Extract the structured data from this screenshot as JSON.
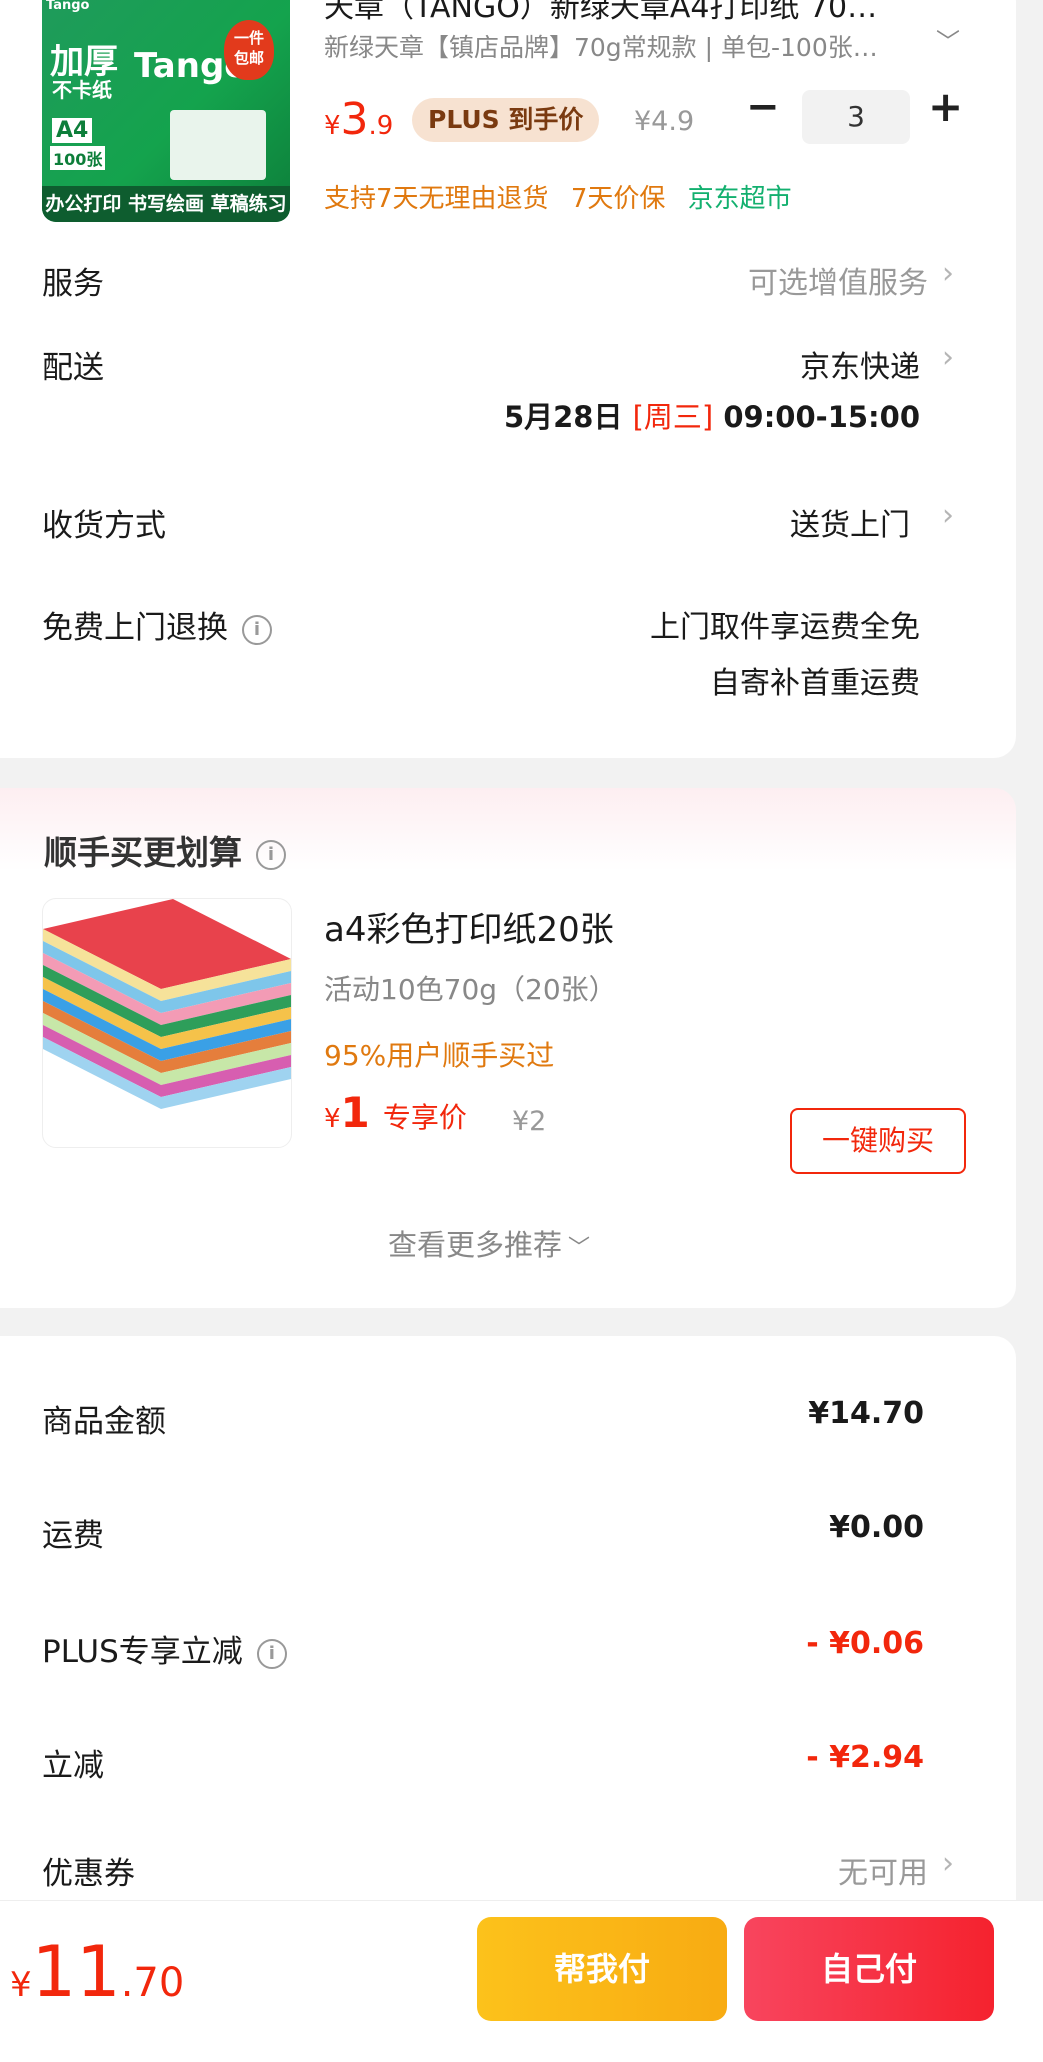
{
  "product": {
    "title": "天章（TANGO）新绿天章A4打印纸 70…",
    "spec": "新绿天章【镇店品牌】70g常规款 | 单包-100张…",
    "price_currency": "¥",
    "price_main": "3",
    "price_decimal": ".9",
    "plus_label": "PLUS 到手价",
    "orig_price": "¥4.9",
    "qty": "3",
    "minus": "−",
    "plus": "+",
    "tags": [
      "支持7天无理由退货",
      "7天价保",
      "京东超市"
    ],
    "image_text": {
      "brand_small": "Tango",
      "line1": "加厚",
      "line2": "不卡纸",
      "brand": "Tango",
      "badge_line1": "一件",
      "badge_line2": "包邮",
      "size": "A4",
      "count": "100张",
      "bottom": "办公打印 书写绘画 草稿练习"
    }
  },
  "service": {
    "label": "服务",
    "value": "可选增值服务"
  },
  "delivery": {
    "label": "配送",
    "value": "京东快递",
    "date": "5月28日",
    "weekday": "[周三]",
    "time": "09:00-15:00"
  },
  "receive": {
    "label": "收货方式",
    "value": "送货上门"
  },
  "free_return": {
    "label": "免费上门退换",
    "line1": "上门取件享运费全免",
    "line2": "自寄补首重运费"
  },
  "addon": {
    "section_title": "顺手买更划算",
    "name": "a4彩色打印纸20张",
    "spec": "活动10色70g（20张）",
    "note": "95%用户顺手买过",
    "price_currency": "¥",
    "price": "1",
    "price_label": "专享价",
    "orig_price": "¥2",
    "buy_button": "一键购买",
    "more": "查看更多推荐"
  },
  "summary": [
    {
      "label": "商品金额",
      "value": "¥14.70",
      "info": false,
      "color": "#1a1a1a"
    },
    {
      "label": "运费",
      "value": "¥0.00",
      "info": false,
      "color": "#1a1a1a"
    },
    {
      "label": "PLUS专享立减",
      "value": "- ¥0.06",
      "info": true,
      "color": "#f2270c"
    },
    {
      "label": "立减",
      "value": "- ¥2.94",
      "info": false,
      "color": "#f2270c"
    },
    {
      "label": "优惠券",
      "value": "无可用",
      "info": false,
      "color": "#999999"
    }
  ],
  "footer": {
    "total_currency": "¥",
    "total_main": "11",
    "total_decimal": ".70",
    "help_pay": "帮我付",
    "self_pay": "自己付"
  },
  "colors": {
    "price_red": "#f2270c",
    "tag_orange": "#e0790f",
    "jd_green": "#13b06f",
    "help_pay_bg": "#fbb41a",
    "self_pay_bg": "#f5254b"
  }
}
